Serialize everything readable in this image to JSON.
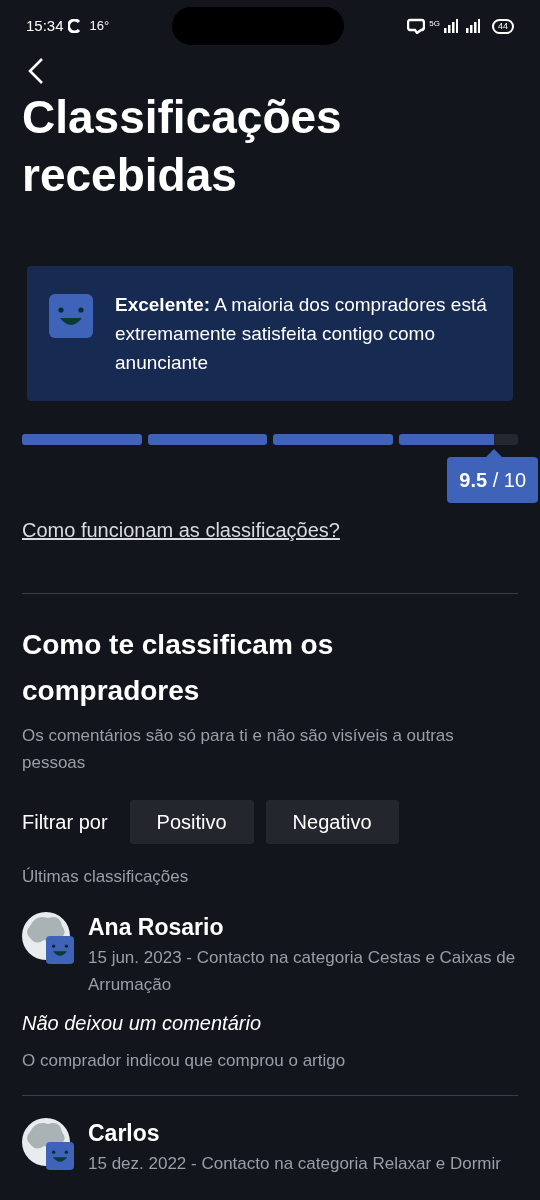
{
  "status_bar": {
    "time": "15:34",
    "temperature": "16°",
    "network": "5G",
    "battery": "44"
  },
  "title": "Classificações recebidas",
  "summary": {
    "text": "**Excelente:** A maioria dos compradores está extremamente satisfeita contigo como anunciante"
  },
  "rating": {
    "level": 0.95,
    "score": "9.5",
    "max": "/ 10"
  },
  "help_link": "Como funcionam as classificações?",
  "section": {
    "title": "Como te classificam os compradores",
    "subtitle": "Os comentários são só para ti e não são visíveis a outras pessoas"
  },
  "filter": {
    "label": "Filtrar por",
    "options": [
      {
        "label": "Positivo",
        "selected": false
      },
      {
        "label": "Negativo",
        "selected": false
      }
    ]
  },
  "latest_label": "Últimas classificações",
  "reviews": [
    {
      "name": "Ana Rosario",
      "meta": "15 jun. 2023 - Contacto na categoria Cestas e Caixas de Arrumação",
      "comment": "Não deixou um comentário",
      "note": "O comprador indicou que comprou o artigo"
    },
    {
      "name": "Carlos",
      "meta": "15 dez. 2022 - Contacto na categoria Relaxar e Dormir"
    }
  ]
}
